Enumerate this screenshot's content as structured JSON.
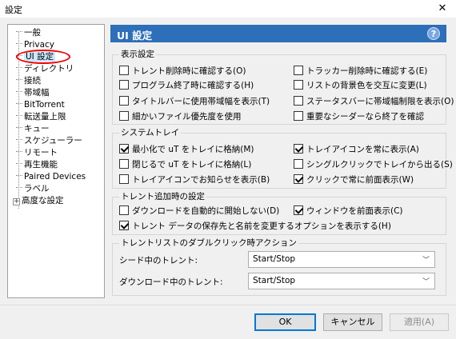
{
  "window": {
    "title": "設定",
    "close_glyph": "✕"
  },
  "tree": {
    "items": [
      {
        "label": "一般"
      },
      {
        "label": "Privacy"
      },
      {
        "label": "UI 設定",
        "selected": true
      },
      {
        "label": "ディレクトリ"
      },
      {
        "label": "接続"
      },
      {
        "label": "帯域幅"
      },
      {
        "label": "BitTorrent"
      },
      {
        "label": "転送量上限"
      },
      {
        "label": "キュー"
      },
      {
        "label": "スケジューラー"
      },
      {
        "label": "リモート"
      },
      {
        "label": "再生機能"
      },
      {
        "label": "Paired Devices"
      },
      {
        "label": "ラベル"
      },
      {
        "label": "高度な設定",
        "expander": "+"
      }
    ]
  },
  "header": {
    "title": "UI 設定",
    "help_glyph": "?"
  },
  "groups": {
    "display": {
      "title": "表示設定",
      "options": [
        {
          "label": "トレント削除時に確認する(O)",
          "checked": false
        },
        {
          "label": "トラッカー削除時に確認する(E)",
          "checked": false
        },
        {
          "label": "プログラム終了時に確認する(H)",
          "checked": false
        },
        {
          "label": "リストの背景色を交互に変更(L)",
          "checked": false
        },
        {
          "label": "タイトルバーに使用帯域幅を表示(T)",
          "checked": false
        },
        {
          "label": "ステータスバーに帯域幅制限を表示(O)",
          "checked": false
        },
        {
          "label": "細かいファイル優先度を使用",
          "checked": false
        },
        {
          "label": "重要なシーダーなら終了を確認",
          "checked": false
        }
      ]
    },
    "tray": {
      "title": "システムトレイ",
      "options": [
        {
          "label": "最小化で uT をトレイに格納(M)",
          "checked": true
        },
        {
          "label": "トレイアイコンを常に表示(A)",
          "checked": true
        },
        {
          "label": "閉じるで uT をトレイに格納(L)",
          "checked": false
        },
        {
          "label": "シングルクリックでトレイから出る(S)",
          "checked": false
        },
        {
          "label": "トレイアイコンでお知らせを表示(B)",
          "checked": false
        },
        {
          "label": "クリックで常に前面表示(W)",
          "checked": true
        }
      ]
    },
    "add": {
      "title": "トレント追加時の設定",
      "options": [
        {
          "label": "ダウンロードを自動的に開始しない(D)",
          "checked": false
        },
        {
          "label": "ウィンドウを前面表示(C)",
          "checked": true
        },
        {
          "label": "トレント データの保存先と名前を変更するオプションを表示する(H)",
          "checked": true
        }
      ]
    },
    "dblclick": {
      "title": "トレントリストのダブルクリック時アクション",
      "rows": [
        {
          "label": "シード中のトレント:",
          "value": "Start/Stop"
        },
        {
          "label": "ダウンロード中のトレント:",
          "value": "Start/Stop"
        }
      ],
      "arrow_glyph": "﹀"
    }
  },
  "buttons": {
    "ok": "OK",
    "cancel": "キャンセル",
    "apply": "適用(A)"
  }
}
